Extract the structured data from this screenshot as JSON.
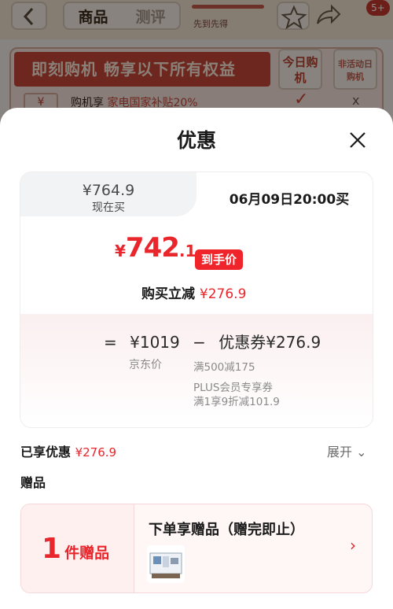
{
  "background": {
    "back_icon": "chevron-left-icon",
    "tabs": [
      "商品",
      "测评"
    ],
    "progress_text": "先到先得",
    "badge": "5+",
    "banner": "即刻购机 畅享以下所有权益",
    "col_today": "今日购机",
    "col_non_event": "非活动日购机",
    "row_icon_text": "¥",
    "row_text": "购机享",
    "row_text_highlight": "家电国家补贴20%",
    "check": "✓",
    "cross": "x"
  },
  "sheet": {
    "title": "优惠",
    "close_icon": "close-icon"
  },
  "price_card": {
    "now_price": "¥764.9",
    "now_label": "现在买",
    "later_text": "06月09日20:00买",
    "final_currency": "¥",
    "final_int": "742",
    "final_dec": ".1",
    "hand_price_badge": "到手价",
    "reduce_label": "购买立减",
    "reduce_amount": "¥276.9",
    "formula_eq": "=",
    "formula_jd": "¥1019",
    "formula_minus": "−",
    "formula_coupon": "优惠券¥276.9",
    "jd_label": "京东价",
    "coupon_desc1": "满500减175",
    "coupon_desc2": "PLUS会员专享券",
    "coupon_desc3": "满1享9折减101.9"
  },
  "enjoyed": {
    "label": "已享优惠",
    "amount": "¥276.9",
    "expand": "展开 ⌄"
  },
  "gifts": {
    "title": "赠品",
    "count": "1",
    "unit": "件赠品",
    "headline": "下单享赠品（赠完即止）",
    "arrow": "›",
    "thumb_icon": "gift-thumbnail-image"
  },
  "colors": {
    "accent_red": "#e8262b",
    "overlay": "rgba(0,0,0,0.45)"
  }
}
